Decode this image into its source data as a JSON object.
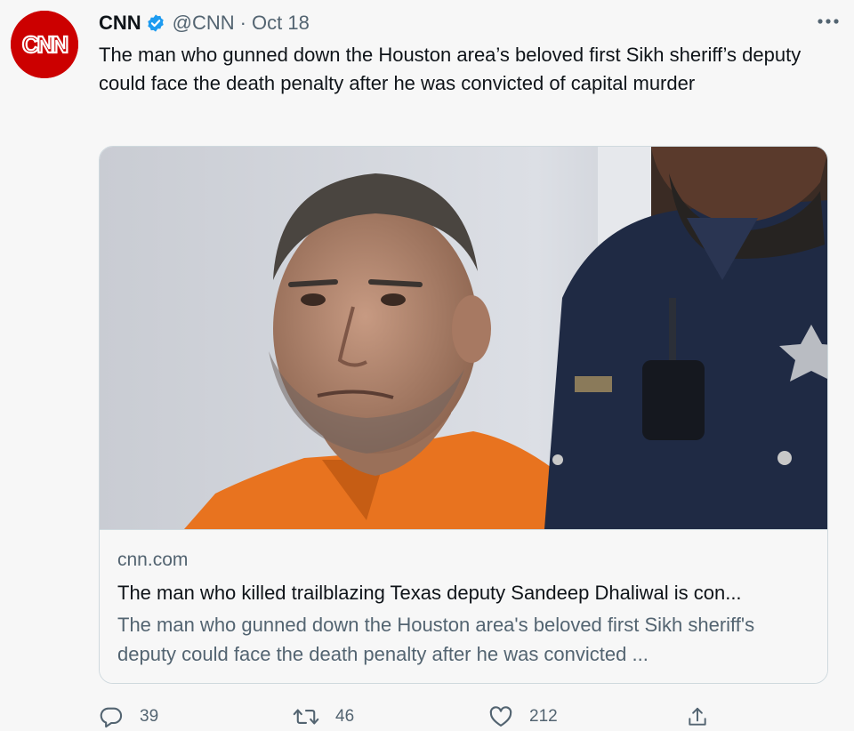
{
  "account": {
    "name": "CNN",
    "handle": "@CNN",
    "separator": "·",
    "date": "Oct 18",
    "avatar_text": "CNN",
    "verified_icon": "verified-badge-icon",
    "brand_color": "#cc0000",
    "verified_color": "#1d9bf0"
  },
  "tweet": {
    "text": "The man who gunned down the Houston area’s beloved first Sikh sheriff’s deputy could face the death penalty after he was convicted of capital murder"
  },
  "card": {
    "domain": "cnn.com",
    "title": "The man who killed trailblazing Texas deputy Sandeep Dhaliwal is con...",
    "description": "The man who gunned down the Houston area's beloved first Sikh sheriff's deputy could face the death penalty after he was convicted ..."
  },
  "actions": {
    "reply_count": "39",
    "retweet_count": "46",
    "like_count": "212",
    "icons": [
      "reply-icon",
      "retweet-icon",
      "like-icon",
      "share-icon"
    ]
  }
}
